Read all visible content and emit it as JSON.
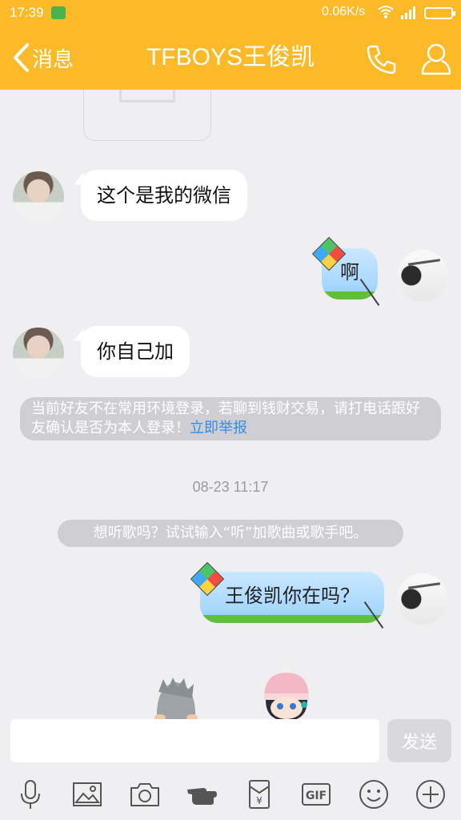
{
  "status_bar": {
    "time": "17:39",
    "network_speed": "0.06K/s",
    "icons": [
      "alarm-icon",
      "wifi-icon",
      "signal-icon",
      "battery-icon"
    ]
  },
  "header": {
    "back_label": "消息",
    "title": "TFBOYS王俊凯",
    "background_color": "#fcb928",
    "icons": [
      "phone-icon",
      "profile-icon"
    ]
  },
  "messages": [
    {
      "side": "incoming",
      "text": "这个是我的微信"
    },
    {
      "side": "outgoing",
      "text": "啊"
    },
    {
      "side": "incoming",
      "text": "你自己加"
    }
  ],
  "security_notice": {
    "text": "当前好友不在常用环境登录，若聊到钱财交易，请打电话跟好友确认是否为本人登录！",
    "link": "立即举报"
  },
  "timestamp": "08-23 11:17",
  "hint": "想听歌吗？试试输入“听”加歌曲或歌手吧。",
  "messages_after": [
    {
      "side": "outgoing",
      "text": "王俊凯你在吗？"
    }
  ],
  "composer": {
    "input_value": "",
    "send_label": "发送"
  },
  "toolbar": {
    "items": [
      "microphone-icon",
      "image-icon",
      "camera-icon",
      "poke-icon",
      "red-packet-icon",
      "gif-icon",
      "emoji-icon",
      "plus-icon"
    ],
    "gif_label": "GIF",
    "red_packet_label": "¥"
  }
}
